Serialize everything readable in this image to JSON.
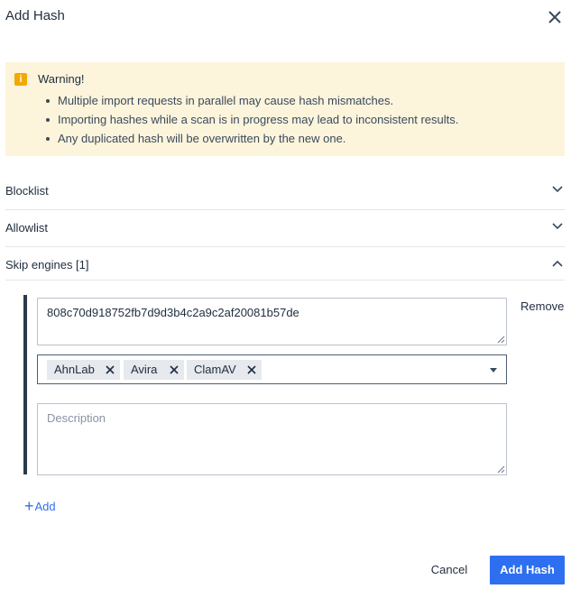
{
  "dialog": {
    "title": "Add Hash",
    "close_icon": "close-icon"
  },
  "warning": {
    "icon": "info-icon",
    "icon_glyph": "i",
    "title": "Warning!",
    "items": [
      "Multiple import requests in parallel may cause hash mismatches.",
      "Importing hashes while a scan is in progress may lead to inconsistent results.",
      "Any duplicated hash will be overwritten by the new one."
    ]
  },
  "accordion": {
    "blocklist": {
      "label": "Blocklist",
      "expanded": false
    },
    "allowlist": {
      "label": "Allowlist",
      "expanded": false
    },
    "skip_engines": {
      "label": "Skip engines [1]",
      "expanded": true
    }
  },
  "entry": {
    "hash_value": "808c70d918752fb7d9d3b4c2a9c2af20081b57de",
    "remove_label": "Remove",
    "engines": [
      "AhnLab",
      "Avira",
      "ClamAV"
    ],
    "description_placeholder": "Description"
  },
  "add_label": "Add",
  "footer": {
    "cancel_label": "Cancel",
    "submit_label": "Add Hash"
  },
  "colors": {
    "primary": "#2e6ff0",
    "warning_bg": "#fdf4dc",
    "warning_icon": "#f2a900"
  }
}
